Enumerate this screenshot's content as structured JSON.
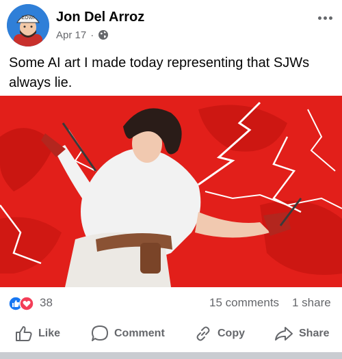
{
  "post": {
    "author": "Jon Del Arroz",
    "date": "Apr 17",
    "separator": "·",
    "privacy_icon": "globe-icon",
    "text": "Some AI art I made today representing that SJWs always lie.",
    "image_alt": "AI artwork of a woman in a white shirt with lightning on a red background"
  },
  "stats": {
    "reaction_icons": [
      "like-icon",
      "love-icon"
    ],
    "reactions": "38",
    "comments": "15 comments",
    "shares": "1 share"
  },
  "actions": {
    "like": "Like",
    "comment": "Comment",
    "copy": "Copy",
    "share": "Share"
  },
  "colors": {
    "like_blue": "#1877f2",
    "love_red": "#f33e58",
    "image_red": "#e21f1a",
    "secondary_text": "#65676b"
  }
}
